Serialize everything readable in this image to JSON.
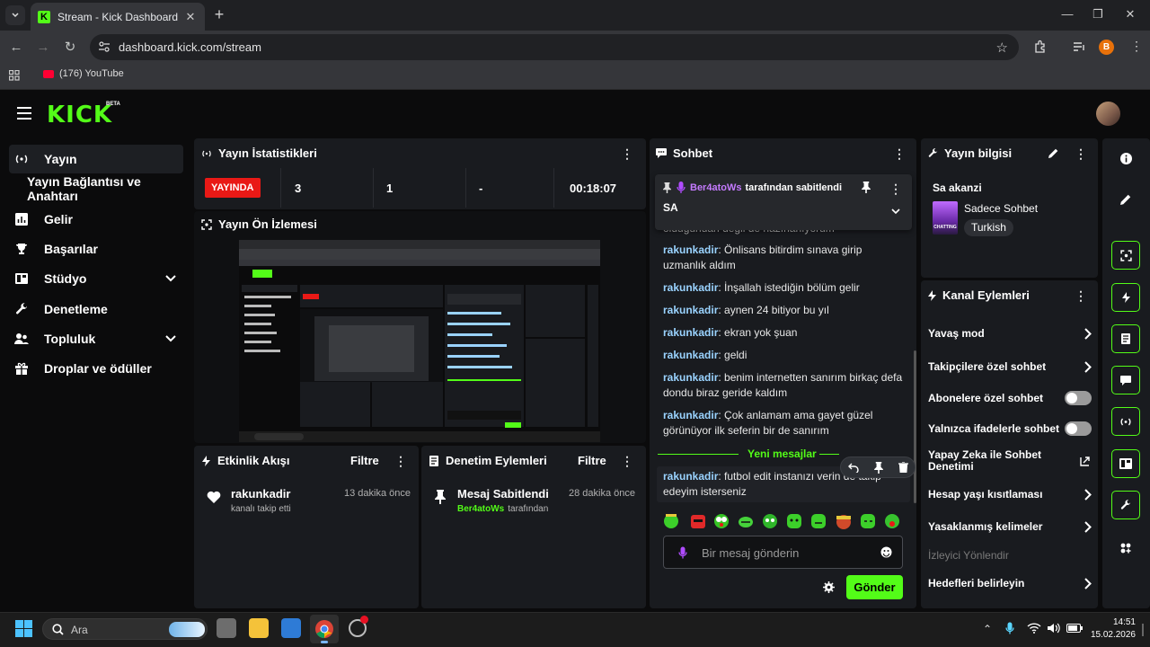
{
  "browser": {
    "tab_title": "Stream - Kick Dashboard",
    "url": "dashboard.kick.com/stream",
    "bookmark": "(176) YouTube",
    "profile_initial": "B"
  },
  "header": {
    "logo": "KICK",
    "beta": "BETA"
  },
  "sidebar": {
    "items": [
      {
        "label": "Yayın",
        "icon": "broadcast-icon"
      },
      {
        "label": "Yayın Bağlantısı ve Anahtarı",
        "icon": ""
      },
      {
        "label": "Gelir",
        "icon": "chart-icon"
      },
      {
        "label": "Başarılar",
        "icon": "trophy-icon"
      },
      {
        "label": "Stüdyo",
        "icon": "studio-icon"
      },
      {
        "label": "Denetleme",
        "icon": "wrench-icon"
      },
      {
        "label": "Topluluk",
        "icon": "people-icon"
      },
      {
        "label": "Droplar ve ödüller",
        "icon": "gift-icon"
      }
    ]
  },
  "stats": {
    "title": "Yayın İstatistikleri",
    "live": "YAYINDA",
    "values": [
      "3",
      "1",
      "-",
      "00:18:07"
    ]
  },
  "preview": {
    "title": "Yayın Ön İzlemesi"
  },
  "activity": {
    "title": "Etkinlik Akışı",
    "filter": "Filtre",
    "item_user": "rakunkadir",
    "item_text": "kanalı takip etti",
    "item_time": "13 dakika önce"
  },
  "moderation": {
    "title": "Denetim Eylemleri",
    "filter": "Filtre",
    "item_title": "Mesaj Sabitlendi",
    "item_user": "Ber4atoWs",
    "item_suffix": "tarafından",
    "item_time": "28 dakika önce"
  },
  "chat": {
    "title": "Sohbet",
    "pinned_by": "Ber4atoWs",
    "pinned_suffix": "tarafından sabitlendi",
    "pinned_text": "SA",
    "partial_line": "olduğundan değil de hazırlanıyorum",
    "messages": [
      {
        "user": "rakunkadir",
        "text": "Önlisans bitirdim sınava girip uzmanlık aldım"
      },
      {
        "user": "rakunkadir",
        "text": "İnşallah istediğin bölüm gelir"
      },
      {
        "user": "rakunkadir",
        "text": "aynen 24 bitiyor bu yıl"
      },
      {
        "user": "rakunkadir",
        "text": "ekran yok şuan"
      },
      {
        "user": "rakunkadir",
        "text": "geldi"
      },
      {
        "user": "rakunkadir",
        "text": "benim internetten sanırım birkaç defa dondu biraz geride kaldım"
      },
      {
        "user": "rakunkadir",
        "text": "Çok anlamam ama gayet güzel görünüyor ilk seferin bir de sanırım"
      }
    ],
    "new_messages": "Yeni mesajlar",
    "last_message": {
      "user": "rakunkadir",
      "text": "futbol edit instanızı verin de takip edeyim isterseniz"
    },
    "input_placeholder": "Bir mesaj gönderin",
    "send": "Gönder"
  },
  "stream_info": {
    "title": "Yayın bilgisi",
    "stream_title": "Sa akanzi",
    "category": "Sadece Sohbet",
    "language": "Turkish",
    "thumb_label": "CHATTING"
  },
  "channel_actions": {
    "title": "Kanal Eylemleri",
    "items": {
      "slow": "Yavaş mod",
      "followers": "Takipçilere özel sohbet",
      "subs": "Abonelere özel sohbet",
      "emotes": "Yalnızca ifadelerle sohbet",
      "ai": "Yapay Zeka ile Sohbet Denetimi",
      "age": "Hesap yaşı kısıtlaması",
      "banned": "Yasaklanmış kelimeler",
      "viewer_dir": "İzleyici Yönlendir",
      "goals": "Hedefleri belirleyin"
    },
    "toggles": {
      "subs": false,
      "emotes": false
    }
  },
  "taskbar": {
    "search": "Ara",
    "time": "14:51",
    "date": "15.02.2026"
  },
  "colors": {
    "accent": "#53fc18",
    "live": "#e91916",
    "panel": "#191b1f"
  }
}
